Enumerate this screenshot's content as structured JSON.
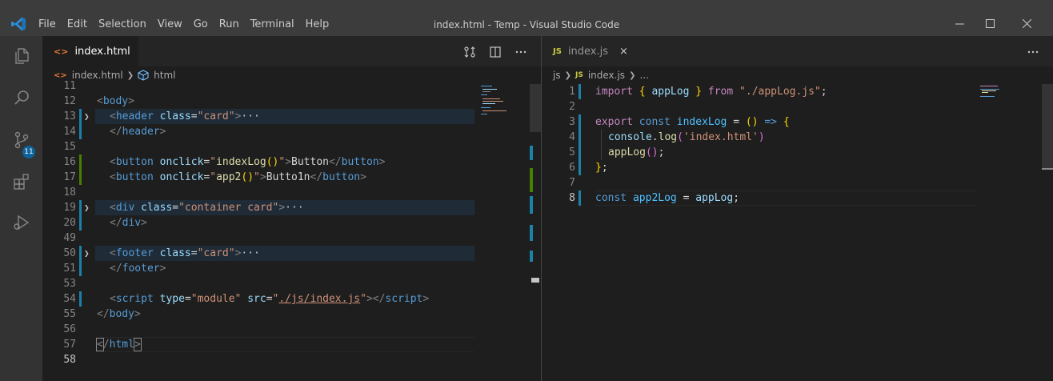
{
  "window": {
    "title": "index.html - Temp - Visual Studio Code",
    "controls": [
      "minimize",
      "maximize",
      "close"
    ]
  },
  "menu": [
    "File",
    "Edit",
    "Selection",
    "View",
    "Go",
    "Run",
    "Terminal",
    "Help"
  ],
  "activity_bar": {
    "items": [
      "explorer-icon",
      "search-icon",
      "source-control-icon",
      "extensions-icon",
      "run-debug-icon"
    ],
    "scm_badge": "11"
  },
  "left_editor": {
    "tab": {
      "icon": "<>",
      "label": "index.html"
    },
    "breadcrumbs": [
      "index.html",
      "html"
    ],
    "lines": [
      {
        "n": "11"
      },
      {
        "n": "12"
      },
      {
        "n": "13"
      },
      {
        "n": "14"
      },
      {
        "n": "15"
      },
      {
        "n": "16"
      },
      {
        "n": "17"
      },
      {
        "n": "18"
      },
      {
        "n": "19"
      },
      {
        "n": "20"
      },
      {
        "n": "49"
      },
      {
        "n": "50"
      },
      {
        "n": "51"
      },
      {
        "n": "53"
      },
      {
        "n": "54"
      },
      {
        "n": "55"
      },
      {
        "n": "56"
      },
      {
        "n": "57"
      },
      {
        "n": "58"
      }
    ]
  },
  "right_editor": {
    "tab": {
      "icon": "JS",
      "label": "index.js",
      "close": "×"
    },
    "breadcrumbs": [
      "js",
      "index.js",
      "..."
    ],
    "lines": [
      {
        "n": "1"
      },
      {
        "n": "2"
      },
      {
        "n": "3"
      },
      {
        "n": "4"
      },
      {
        "n": "5"
      },
      {
        "n": "6"
      },
      {
        "n": "7"
      },
      {
        "n": "8"
      }
    ]
  },
  "colors": {
    "titlebar": "#3c3c3c",
    "activity_bar": "#333333",
    "editor_bg": "#1e1e1e",
    "tag": "#569cd6",
    "attribute": "#9cdcfe",
    "string": "#ce9178",
    "keyword": "#c586c0",
    "function": "#dcdcaa",
    "badge": "#0e639c"
  }
}
